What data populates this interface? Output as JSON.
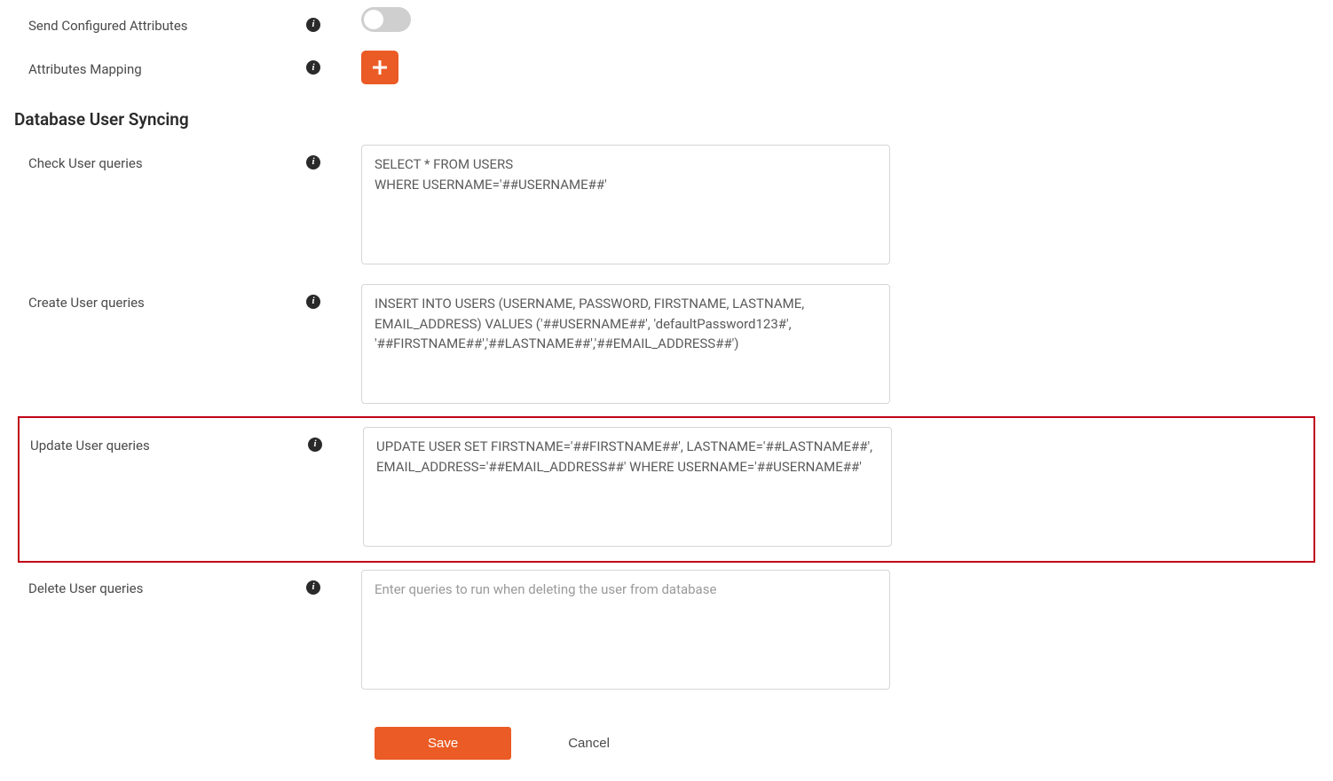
{
  "fields": {
    "send_configured_attributes": {
      "label": "Send Configured Attributes"
    },
    "attributes_mapping": {
      "label": "Attributes Mapping"
    }
  },
  "section": {
    "database_user_syncing": "Database User Syncing"
  },
  "queries": {
    "check_user": {
      "label": "Check User queries",
      "value": "SELECT * FROM USERS\nWHERE USERNAME='##USERNAME##'"
    },
    "create_user": {
      "label": "Create User queries",
      "value": "INSERT INTO USERS (USERNAME, PASSWORD, FIRSTNAME, LASTNAME, EMAIL_ADDRESS) VALUES ('##USERNAME##', 'defaultPassword123#', '##FIRSTNAME##','##LASTNAME##','##EMAIL_ADDRESS##')"
    },
    "update_user": {
      "label": "Update User queries",
      "value": "UPDATE USER SET FIRSTNAME='##FIRSTNAME##', LASTNAME='##LASTNAME##', EMAIL_ADDRESS='##EMAIL_ADDRESS##' WHERE USERNAME='##USERNAME##'"
    },
    "delete_user": {
      "label": "Delete User queries",
      "placeholder": "Enter queries to run when deleting the user from database",
      "value": ""
    }
  },
  "buttons": {
    "save": "Save",
    "cancel": "Cancel"
  }
}
